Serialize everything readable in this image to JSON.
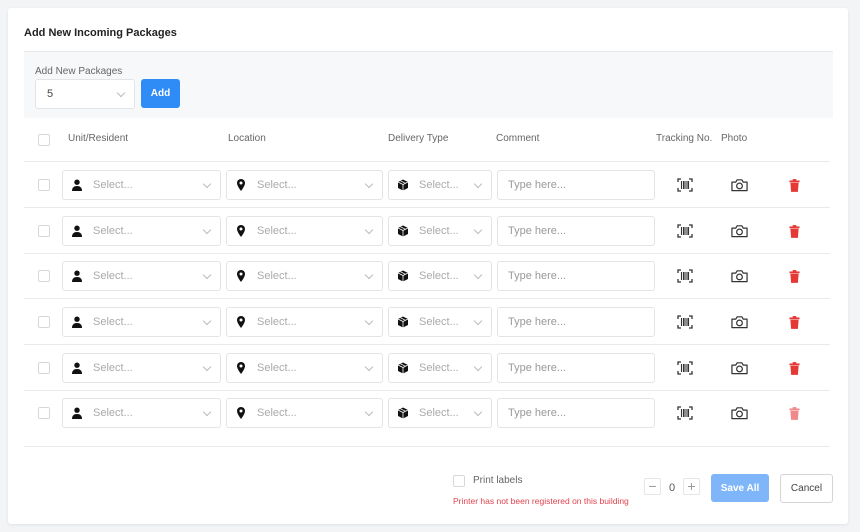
{
  "title": "Add New Incoming Packages",
  "add_section": {
    "label": "Add New Packages",
    "quantity": "5",
    "add_button": "Add"
  },
  "columns": [
    "Unit/Resident",
    "Location",
    "Delivery Type",
    "Comment",
    "Tracking No.",
    "Photo"
  ],
  "rows": [
    {
      "unit": "Select...",
      "location": "Select...",
      "delivery": "Select...",
      "comment_placeholder": "Type here...",
      "delete_enabled": true
    },
    {
      "unit": "Select...",
      "location": "Select...",
      "delivery": "Select...",
      "comment_placeholder": "Type here...",
      "delete_enabled": true
    },
    {
      "unit": "Select...",
      "location": "Select...",
      "delivery": "Select...",
      "comment_placeholder": "Type here...",
      "delete_enabled": true
    },
    {
      "unit": "Select...",
      "location": "Select...",
      "delivery": "Select...",
      "comment_placeholder": "Type here...",
      "delete_enabled": true
    },
    {
      "unit": "Select...",
      "location": "Select...",
      "delivery": "Select...",
      "comment_placeholder": "Type here...",
      "delete_enabled": true
    },
    {
      "unit": "Select...",
      "location": "Select...",
      "delivery": "Select...",
      "comment_placeholder": "Type here...",
      "delete_enabled": false
    }
  ],
  "footer": {
    "print_labels": "Print labels",
    "printer_warning": "Printer has not been registered on this building",
    "counter": "0",
    "save_all": "Save All",
    "cancel": "Cancel"
  },
  "colors": {
    "primary": "#2f8cf6",
    "primary_disabled": "#7fb6fa",
    "danger": "#e53935",
    "warning_text": "#e0434f"
  }
}
